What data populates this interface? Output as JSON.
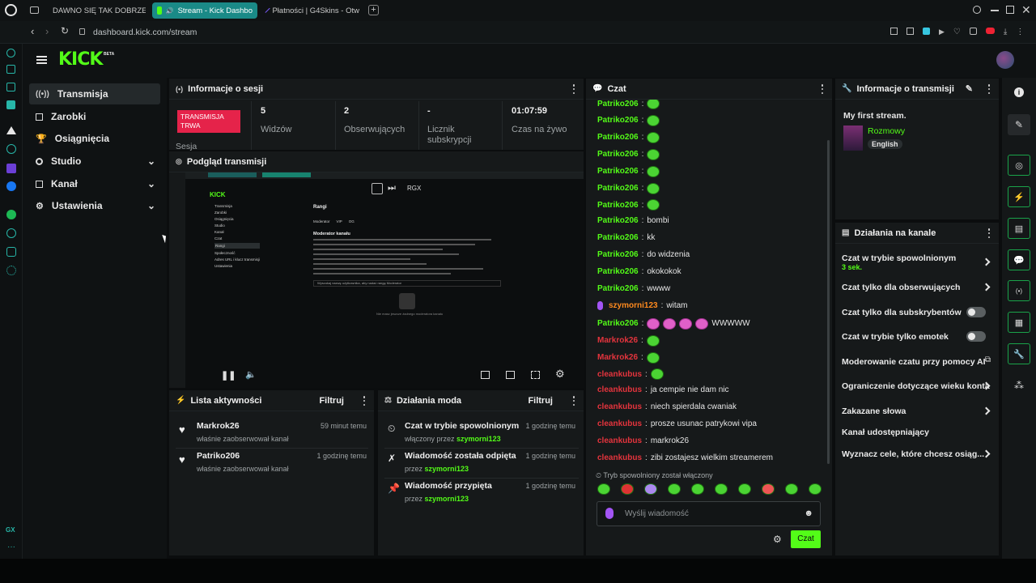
{
  "browser": {
    "tabs": [
      {
        "title": "DAWNO SIĘ TAK DOBRZE",
        "icon": "youtube-icon",
        "color": "#ff0000"
      },
      {
        "title": "Stream - Kick Dashbo",
        "icon": "kick-tab-icon",
        "color": "#53fc18",
        "active": true
      },
      {
        "title": "Płatności | G4Skins - Otw",
        "icon": "g4skins-icon",
        "color": "#7b5cff"
      }
    ],
    "url": "dashboard.kick.com/stream"
  },
  "app": {
    "logo": "KICK",
    "logo_badge": "BETA",
    "nav": [
      {
        "label": "Transmisja",
        "icon": "broadcast-icon",
        "active": true
      },
      {
        "label": "Zarobki",
        "icon": "earnings-icon"
      },
      {
        "label": "Osiągnięcia",
        "icon": "trophy-icon"
      },
      {
        "label": "Studio",
        "icon": "studio-icon",
        "expandable": true
      },
      {
        "label": "Kanał",
        "icon": "channel-icon",
        "expandable": true
      },
      {
        "label": "Ustawienia",
        "icon": "settings-icon",
        "expandable": true
      }
    ]
  },
  "session": {
    "title": "Informacje o sesji",
    "status_badge": "TRANSMISJA TRWA",
    "session_label": "Sesja",
    "stats": [
      {
        "value": "5",
        "label": "Widzów"
      },
      {
        "value": "2",
        "label": "Obserwujących"
      },
      {
        "value": "-",
        "label": "Licznik subskrypcji"
      },
      {
        "value": "01:07:59",
        "label": "Czas na żywo"
      }
    ]
  },
  "preview": {
    "title": "Podgląd transmisji",
    "inner": {
      "section_title": "Rangi",
      "tabs": [
        "Moderator",
        "VIP",
        "OG"
      ],
      "card_title": "Moderator kanału",
      "search_placeholder": "Wyszukaj nazwę użytkownika, aby nadać rangę Moderator",
      "empty_text": "Nie masz jeszcze żadnego moderatora kanału",
      "nav": [
        "Transmisja",
        "Zarobki",
        "Osiągnięcia",
        "Studio",
        "Kanał",
        "Czat",
        "Rangi",
        "Społeczność",
        "Adres URL i klucz transmisji",
        "Ustawienia"
      ],
      "overlay_label": "RGX"
    }
  },
  "activity": {
    "title": "Lista aktywności",
    "filter": "Filtruj",
    "items": [
      {
        "user": "Markrok26",
        "text": "właśnie zaobserwował kanał",
        "time": "59 minut temu"
      },
      {
        "user": "Patriko206",
        "text": "właśnie zaobserwował kanał",
        "time": "1 godzinę temu"
      }
    ]
  },
  "modactions": {
    "title": "Działania moda",
    "filter": "Filtruj",
    "items": [
      {
        "title": "Czat w trybie spowolnionym",
        "by_prefix": "włączony przez",
        "by": "szymorni123",
        "time": "1 godzinę temu",
        "icon": "slow-mode-icon"
      },
      {
        "title": "Wiadomość została odpięta",
        "by_prefix": "przez",
        "by": "szymorni123",
        "time": "1 godzinę temu",
        "icon": "unpin-icon"
      },
      {
        "title": "Wiadomość przypięta",
        "by_prefix": "przez",
        "by": "szymorni123",
        "time": "1 godzinę temu",
        "icon": "pin-icon"
      }
    ]
  },
  "chat": {
    "title": "Czat",
    "messages": [
      {
        "user": "Patriko206",
        "color": "#53fc18",
        "text": "",
        "emotes": 1
      },
      {
        "user": "Patriko206",
        "color": "#53fc18",
        "text": "",
        "emotes": 1
      },
      {
        "user": "Patriko206",
        "color": "#53fc18",
        "text": "",
        "emotes": 1
      },
      {
        "user": "Patriko206",
        "color": "#53fc18",
        "text": "",
        "emotes": 1
      },
      {
        "user": "Patriko206",
        "color": "#53fc18",
        "text": "",
        "emotes": 1
      },
      {
        "user": "Patriko206",
        "color": "#53fc18",
        "text": "",
        "emotes": 1
      },
      {
        "user": "Patriko206",
        "color": "#53fc18",
        "text": "",
        "emotes": 1
      },
      {
        "user": "Patriko206",
        "color": "#53fc18",
        "text": "bombi",
        "emotes": 0
      },
      {
        "user": "Patriko206",
        "color": "#53fc18",
        "text": "kk",
        "emotes": 0
      },
      {
        "user": "Patriko206",
        "color": "#53fc18",
        "text": "do widzenia",
        "emotes": 0
      },
      {
        "user": "Patriko206",
        "color": "#53fc18",
        "text": "okokokok",
        "emotes": 0
      },
      {
        "user": "Patriko206",
        "color": "#53fc18",
        "text": "wwww",
        "emotes": 0
      },
      {
        "user": "szymorni123",
        "color": "#ff8a1e",
        "text": "witam",
        "emotes": 0,
        "badge": true
      },
      {
        "user": "Patriko206",
        "color": "#53fc18",
        "text": "WWWWW",
        "emotes": 4
      },
      {
        "user": "Markrok26",
        "color": "#e5343d",
        "text": "",
        "emotes": 1
      },
      {
        "user": "Markrok26",
        "color": "#e5343d",
        "text": "",
        "emotes": 1
      },
      {
        "user": "cleankubus",
        "color": "#e5343d",
        "text": "",
        "emotes": 1
      },
      {
        "user": "cleankubus",
        "color": "#e5343d",
        "text": "ja cempie nie dam nic",
        "emotes": 0
      },
      {
        "user": "cleankubus",
        "color": "#e5343d",
        "text": "niech spierdala cwaniak",
        "emotes": 0
      },
      {
        "user": "cleankubus",
        "color": "#e5343d",
        "text": "prosze usunac patrykowi vipa",
        "emotes": 0
      },
      {
        "user": "cleankubus",
        "color": "#e5343d",
        "text": "markrok26",
        "emotes": 0
      },
      {
        "user": "cleankubus",
        "color": "#e5343d",
        "text": "zibi zostajesz wielkim streamerem",
        "emotes": 0
      }
    ],
    "slow_mode_notice": "Tryb spowolniony został włączony",
    "input_placeholder": "Wyślij wiadomość",
    "send_label": "Czat"
  },
  "stream_info": {
    "title": "Informacje o transmisji",
    "stream_title": "My first stream.",
    "category": "Rozmowy",
    "language": "English"
  },
  "channel_actions": {
    "title": "Działania na kanale",
    "items": [
      {
        "label": "Czat w trybie spowolnionym",
        "sub": "3 sek.",
        "control": "chevron"
      },
      {
        "label": "Czat tylko dla obserwujących",
        "control": "chevron"
      },
      {
        "label": "Czat tylko dla subskrybentów",
        "control": "toggle"
      },
      {
        "label": "Czat w trybie tylko emotek",
        "control": "toggle"
      },
      {
        "label": "Moderowanie czatu przy pomocy AI",
        "control": "external"
      },
      {
        "label": "Ograniczenie dotyczące wieku konta",
        "control": "chevron"
      },
      {
        "label": "Zakazane słowa",
        "control": "chevron"
      },
      {
        "label": "Kanał udostępniający",
        "control": "none"
      },
      {
        "label": "Wyznacz cele, które chcesz osiąg...",
        "control": "chevron"
      }
    ]
  },
  "colors": {
    "accent": "#53fc18",
    "live": "#e5234a",
    "teal": "#1a8a87"
  },
  "gx_label": "GX"
}
